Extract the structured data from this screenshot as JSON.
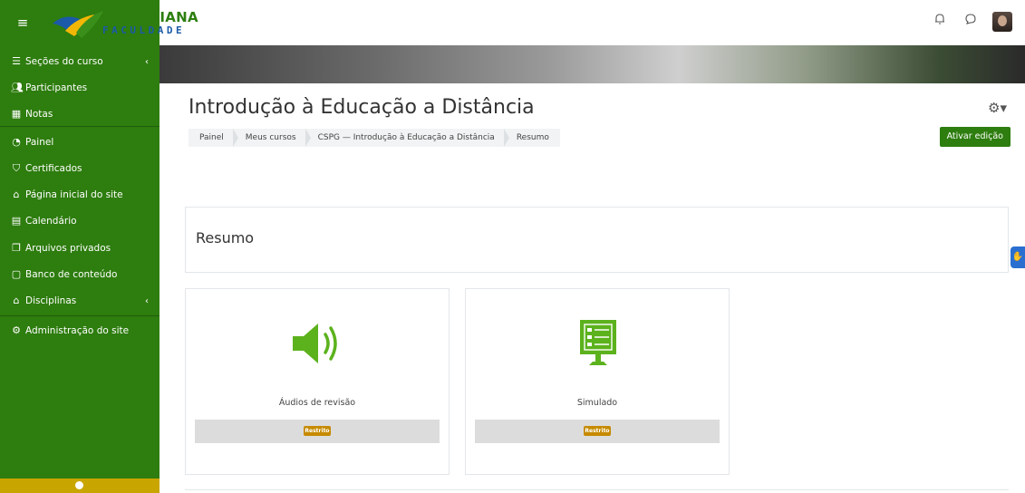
{
  "app": {
    "logo_text": "BRASILIANA",
    "logo_sub": "FACULDADE"
  },
  "colors": {
    "brand_green": "#2e7d0f",
    "badge": "#c68a00",
    "icon_green": "#5cb21d"
  },
  "sidebar": {
    "items": [
      {
        "label": "Seções do curso",
        "icon": "list-icon",
        "chevron": "‹"
      },
      {
        "label": "Participantes",
        "icon": "users-icon"
      },
      {
        "label": "Notas",
        "icon": "grades-icon"
      },
      {
        "label": "Painel",
        "icon": "dashboard-icon"
      },
      {
        "label": "Certificados",
        "icon": "certificate-icon"
      },
      {
        "label": "Página inicial do site",
        "icon": "home-icon"
      },
      {
        "label": "Calendário",
        "icon": "calendar-icon"
      },
      {
        "label": "Arquivos privados",
        "icon": "files-icon"
      },
      {
        "label": "Banco de conteúdo",
        "icon": "content-bank-icon"
      },
      {
        "label": "Disciplinas",
        "icon": "courses-icon",
        "chevron": "‹"
      },
      {
        "label": "Administração do site",
        "icon": "admin-gear-icon"
      }
    ]
  },
  "header": {
    "title": "Introdução à Educação a Distância",
    "breadcrumbs": [
      "Painel",
      "Meus cursos",
      "CSPG — Introdução à Educação a Distância",
      "Resumo"
    ],
    "edit_button": "Ativar edição"
  },
  "summary": {
    "title": "Resumo"
  },
  "cards": [
    {
      "label": "Áudios de revisão",
      "icon": "speaker-icon",
      "badge": "Restrito"
    },
    {
      "label": "Simulado",
      "icon": "quiz-monitor-icon",
      "badge": "Restrito"
    }
  ]
}
